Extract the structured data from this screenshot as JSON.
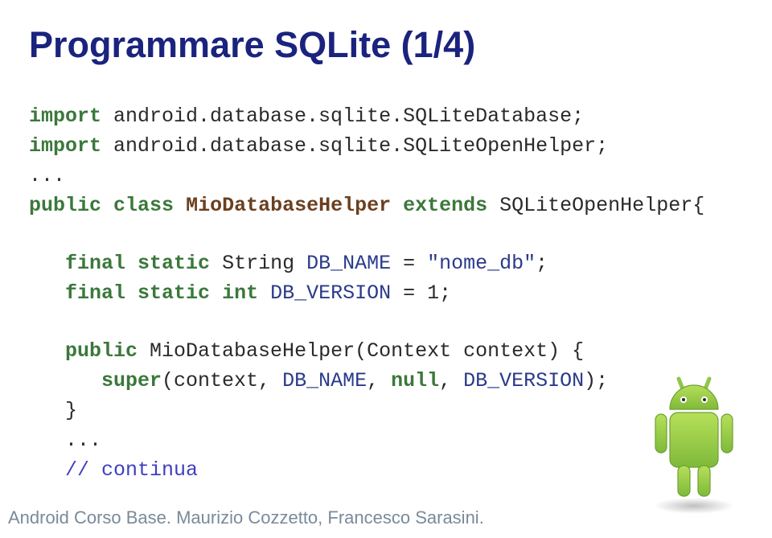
{
  "title": "Programmare SQLite (1/4)",
  "code": {
    "l1_green": "import",
    "l1_rest": " android.database.sqlite.SQLiteDatabase;",
    "l2_green": "import",
    "l2_rest": " android.database.sqlite.SQLiteOpenHelper;",
    "l3_ellipsis": "...",
    "l4_green1": "public",
    "l4_green2": "class",
    "l4_brown": "MioDatabaseHelper",
    "l4_rest1": " ",
    "l4_green3": "extends",
    "l4_rest2": " SQLiteOpenHelper{",
    "l5_indent": "   ",
    "l5_green1": "final",
    "l5_green2": "static",
    "l5_rest1": " String ",
    "l5_blue": "DB_NAME",
    "l5_rest2": " = ",
    "l5_blue2": "\"nome_db\"",
    "l5_rest3": ";",
    "l6_indent": "   ",
    "l6_green1": "final",
    "l6_green2": "static",
    "l6_green3": "int",
    "l6_rest1": " ",
    "l6_blue": "DB_VERSION",
    "l6_rest2": " = 1;",
    "l7_indent": "   ",
    "l7_green": "public",
    "l7_rest": " MioDatabaseHelper(Context context) {",
    "l8_indent": "      ",
    "l8_green": "super",
    "l8_rest1": "(context, ",
    "l8_blue1": "DB_NAME",
    "l8_rest2": ", ",
    "l8_green2": "null",
    "l8_rest3": ", ",
    "l8_blue2": "DB_VERSION",
    "l8_rest4": ");",
    "l9_rest": "   }",
    "l10_indent": "   ",
    "l10_ellipsis": "...",
    "l11_indent": "   ",
    "l11_comment": "// continua"
  },
  "footer": "Android Corso Base. Maurizio Cozzetto, Francesco Sarasini.",
  "icon": "android-icon"
}
